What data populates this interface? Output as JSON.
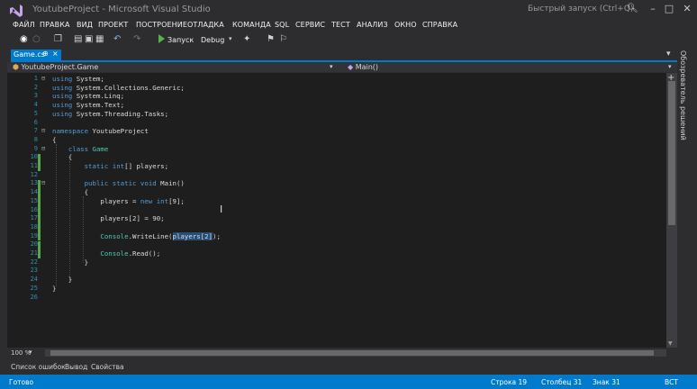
{
  "window": {
    "title": "YoutubeProject - Microsoft Visual Studio",
    "quick_launch_placeholder": "Быстрый запуск (Ctrl+Q)"
  },
  "menu": [
    "ФАЙЛ",
    "ПРАВКА",
    "ВИД",
    "ПРОЕКТ",
    "ПОСТРОЕНИЕ",
    "ОТЛАДКА",
    "КОМАНДА",
    "SQL",
    "СЕРВИС",
    "ТЕСТ",
    "АНАЛИЗ",
    "ОКНО",
    "СПРАВКА"
  ],
  "toolbar": {
    "run_label": "Запуск",
    "configuration": "Debug"
  },
  "document_tab": {
    "label": "Game.cs",
    "pin_glyph": "⊕",
    "close_glyph": "×"
  },
  "navigation": {
    "type_scope": "YoutubeProject.Game",
    "member_scope": "Main()"
  },
  "editor": {
    "line_numbers": [
      "1",
      "2",
      "3",
      "4",
      "5",
      "6",
      "7",
      "8",
      "9",
      "10",
      "11",
      "12",
      "13",
      "14",
      "15",
      "16",
      "17",
      "18",
      "19",
      "20",
      "21",
      "22",
      "23",
      "24",
      "25",
      "26"
    ],
    "lines": [
      "using System;",
      "using System.Collections.Generic;",
      "using System.Linq;",
      "using System.Text;",
      "using System.Threading.Tasks;",
      "",
      "namespace YoutubeProject",
      "{",
      "    class Game",
      "    {",
      "        static int[] players;",
      "",
      "        public static void Main()",
      "        {",
      "            players = new int[9];",
      "",
      "            players[2] = 90;",
      "",
      "            Console.WriteLine(players[2]);",
      "",
      "            Console.Read();",
      "        }",
      "",
      "    }",
      "}",
      ""
    ]
  },
  "side_panel": {
    "solution_explorer": "Обозреватель решений"
  },
  "zoom": "100 %",
  "tool_tabs": [
    "Список ошибок",
    "Вывод",
    "Свойства"
  ],
  "status": {
    "state": "Готово",
    "line": "Строка 19",
    "column": "Столбец 31",
    "char": "Знак 31",
    "mode": "ВСТ"
  },
  "colors": {
    "accent": "#007acc",
    "editor_bg": "#1e1e1e",
    "keyword": "#569cd6",
    "type": "#4ec9b0",
    "line_number": "#2b91af",
    "change_marker": "#57a64a"
  }
}
